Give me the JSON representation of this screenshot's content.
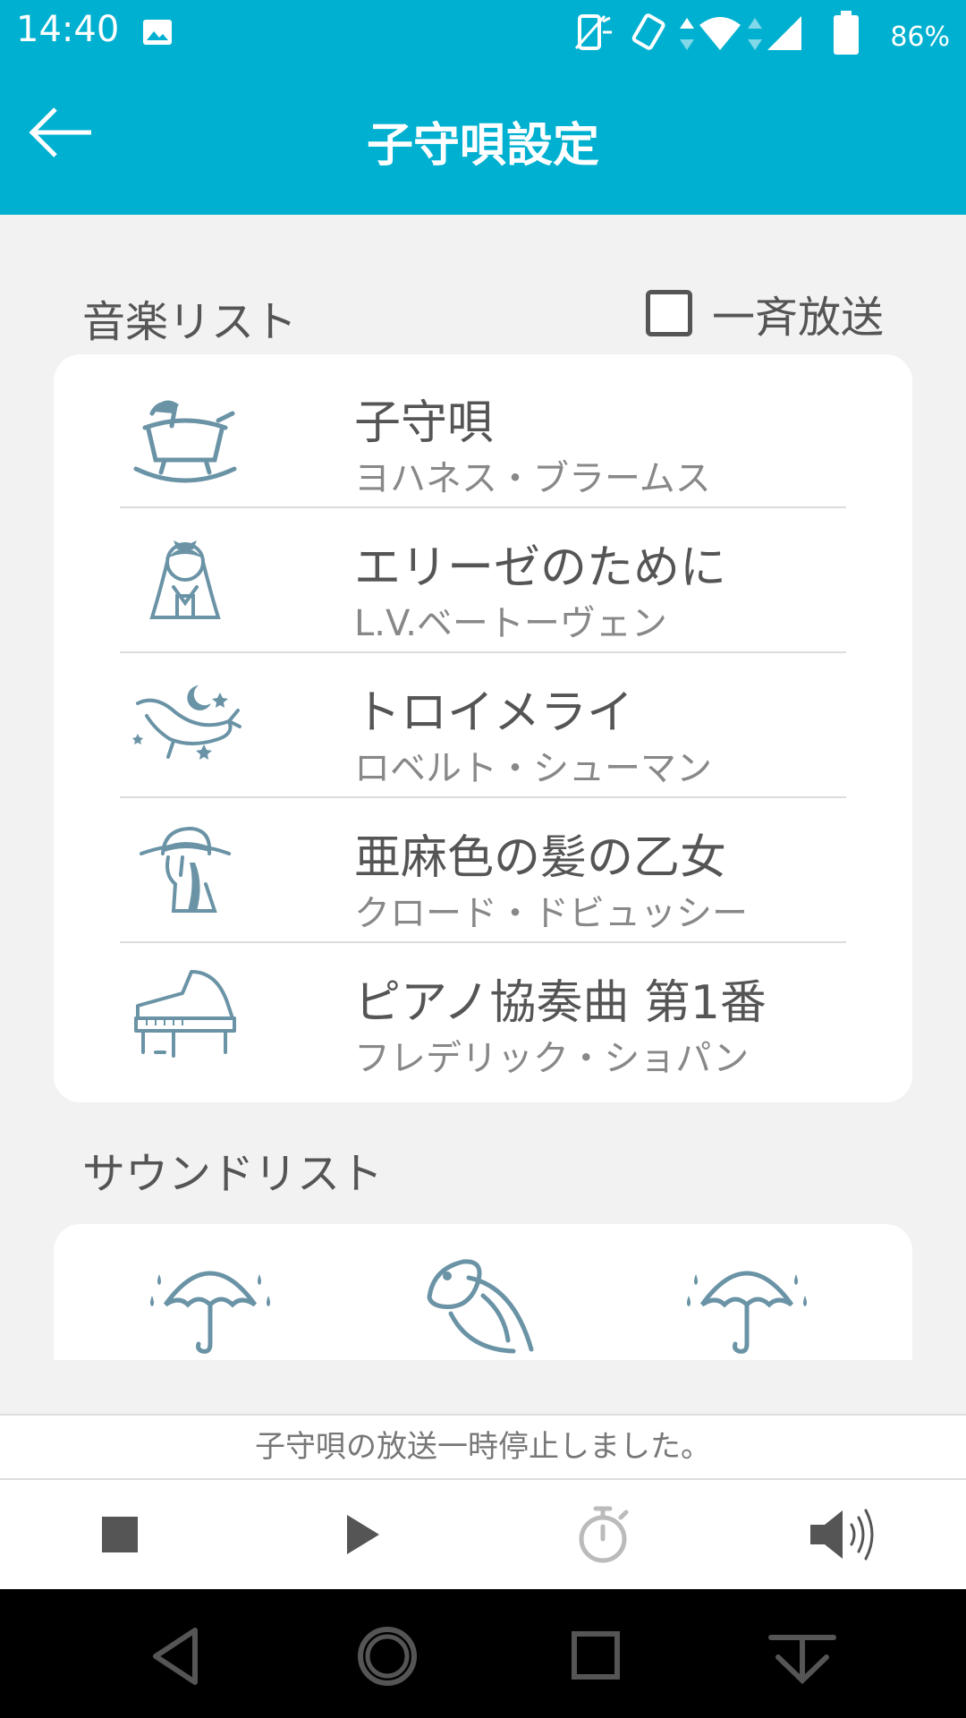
{
  "status": {
    "time": "14:40",
    "battery": "86%"
  },
  "app_bar": {
    "title": "子守唄設定"
  },
  "music_section": {
    "title": "音楽リスト",
    "broadcast_label": "一斉放送",
    "items": [
      {
        "title": "子守唄",
        "composer": "ヨハネス・ブラームス",
        "icon": "cradle-icon"
      },
      {
        "title": "エリーゼのために",
        "composer": "L.V.ベートーヴェン",
        "icon": "girl-icon"
      },
      {
        "title": "トロイメライ",
        "composer": "ロベルト・シューマン",
        "icon": "whale-moon-icon"
      },
      {
        "title": "亜麻色の髪の乙女",
        "composer": "クロード・ドビュッシー",
        "icon": "girl-hat-icon"
      },
      {
        "title": "ピアノ協奏曲 第1番",
        "composer": "フレデリック・ショパン",
        "icon": "piano-icon"
      }
    ]
  },
  "sound_section": {
    "title": "サウンドリスト",
    "items": [
      {
        "icon": "umbrella-rain-icon"
      },
      {
        "icon": "fish-river-icon"
      },
      {
        "icon": "umbrella-rain-icon"
      }
    ]
  },
  "message": "子守唄の放送一時停止しました。",
  "colors": {
    "accent": "#00b0d0",
    "icon": "#6a93a6"
  }
}
